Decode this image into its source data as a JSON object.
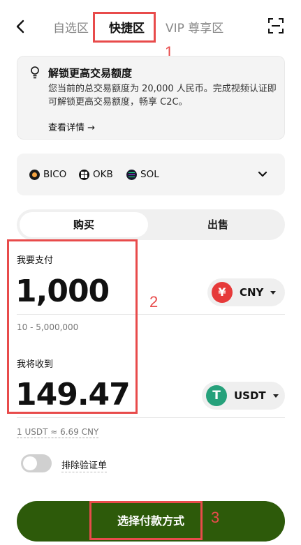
{
  "header": {
    "tabs": [
      {
        "label": "自选区",
        "active": false
      },
      {
        "label": "快捷区",
        "active": true
      },
      {
        "label": "VIP 尊享区",
        "active": false
      }
    ]
  },
  "notice": {
    "title": "解锁更高交易额度",
    "description": "您当前的总交易额度为 20,000 人民币。完成视频认证即可解锁更高交易额度，畅享 C2C。",
    "more_label": "查看详情 →"
  },
  "coins": [
    "BICO",
    "OKB",
    "SOL"
  ],
  "trade_tabs": {
    "buy": "购买",
    "sell": "出售"
  },
  "pay": {
    "label": "我要支付",
    "amount": "1,000",
    "currency": "CNY",
    "currency_glyph": "¥",
    "range": "10 - 5,000,000"
  },
  "receive": {
    "label": "我将收到",
    "amount": "149.47",
    "currency": "USDT",
    "currency_glyph": "T"
  },
  "rate": "1 USDT ≈ 6.69 CNY",
  "exclude_verified": {
    "label": "排除验证单",
    "on": false
  },
  "cta": "选择付款方式",
  "annotations": [
    "1",
    "2",
    "3"
  ],
  "colors": {
    "cta_bg": "#2d5a0a",
    "annotation": "#e84b4b",
    "cny_icon": "#e63a3a",
    "usdt_icon": "#26a17b"
  }
}
